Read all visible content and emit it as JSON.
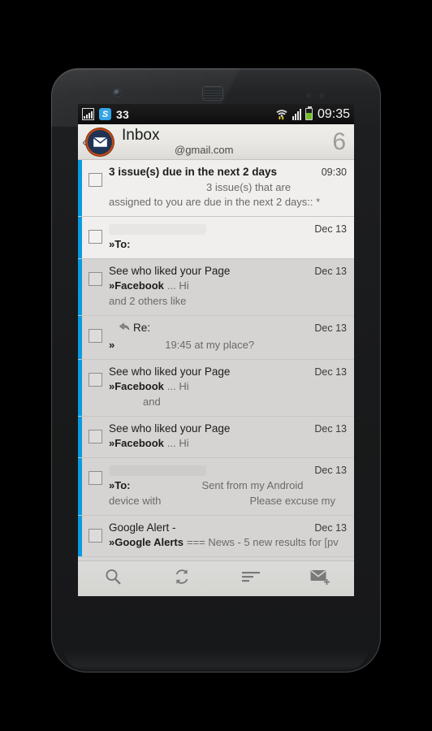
{
  "device": {
    "name": "android-phone-mockup",
    "front_camera_icon": "camera-icon",
    "speaker_icon": "speaker-grille-icon"
  },
  "status_bar": {
    "signal_box_icon": "signal-bars-boxed-icon",
    "skype_icon_label": "S",
    "sms_count": "33",
    "wifi_icon": "wifi-with-transfer-arrows-icon",
    "signal_icon": "signal-bars-icon",
    "battery_icon": "battery-icon",
    "clock": "09:35",
    "battery_color": "#6fbf2a",
    "accent_arrow_color": "#e8d020"
  },
  "header": {
    "back_label": "‹",
    "avatar_icon": "envelope-avatar-icon",
    "title": "Inbox",
    "subtitle": "@gmail.com",
    "unread_count": "6",
    "accent_color": "#0a9ae0"
  },
  "messages": [
    {
      "state": "unread",
      "subject": "3 issue(s) due in the next 2 days",
      "date": "09:30",
      "sender": "",
      "snippet": "3 issue(s) that are",
      "line3": "assigned to you are due in the next 2 days:: *",
      "has_reply_icon": false,
      "redacted_sender": true,
      "snippet_indent": 120,
      "line3_indent": 0
    },
    {
      "state": "unread",
      "subject": "",
      "date": "Dec 13",
      "sender": "»To:",
      "snippet": "",
      "line3": "",
      "has_reply_icon": false,
      "redacted_sender": true,
      "snippet_indent": 0,
      "line3_indent": 0
    },
    {
      "state": "read",
      "subject": "See who liked your Page",
      "date": "Dec 13",
      "sender": "»Facebook",
      "snippet": "... Hi",
      "line3": "and 2 others like",
      "has_reply_icon": false,
      "redacted_sender": false,
      "snippet_indent": 0,
      "line3_indent": 0
    },
    {
      "state": "read",
      "subject": "Re:",
      "date": "Dec 13",
      "sender": "»",
      "snippet": "19:45 at my place?",
      "line3": "",
      "has_reply_icon": true,
      "redacted_sender": false,
      "snippet_indent": 58,
      "line3_indent": 0
    },
    {
      "state": "read",
      "subject": "See who liked your Page",
      "date": "Dec 13",
      "sender": "»Facebook",
      "snippet": "... Hi",
      "line3": "and",
      "has_reply_icon": false,
      "redacted_sender": false,
      "snippet_indent": 0,
      "line3_indent": 42
    },
    {
      "state": "read",
      "subject": "See who liked your Page",
      "date": "Dec 13",
      "sender": "»Facebook",
      "snippet": "... Hi",
      "line3": "",
      "has_reply_icon": false,
      "redacted_sender": false,
      "snippet_indent": 0,
      "line3_indent": 0
    },
    {
      "state": "read",
      "subject": "",
      "date": "Dec 13",
      "sender": "»To:",
      "snippet": "Sent from my Android",
      "line3": "device with",
      "line3_right": "Please excuse my",
      "has_reply_icon": false,
      "redacted_sender": true,
      "snippet_indent": 84,
      "line3_indent": 0
    },
    {
      "state": "read",
      "subject": "Google Alert -",
      "date": "Dec 13",
      "sender": "»Google Alerts",
      "snippet": "=== News - 5 new results for [pv",
      "line3": "",
      "has_reply_icon": false,
      "redacted_sender": false,
      "snippet_indent": 0,
      "line3_indent": 0
    }
  ],
  "toolbar": {
    "items": [
      {
        "icon": "search-icon",
        "label": "Search"
      },
      {
        "icon": "refresh-icon",
        "label": "Refresh"
      },
      {
        "icon": "sort-icon",
        "label": "Sort"
      },
      {
        "icon": "compose-icon",
        "label": "Compose"
      }
    ]
  }
}
